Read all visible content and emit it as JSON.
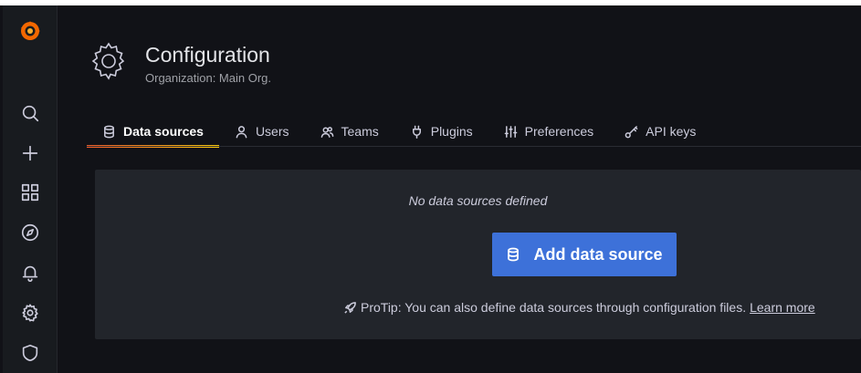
{
  "sidebar": {
    "logo": "grafana-logo",
    "items": [
      {
        "icon": "search-icon"
      },
      {
        "icon": "plus-icon"
      },
      {
        "icon": "dashboards-icon"
      },
      {
        "icon": "explore-compass-icon"
      },
      {
        "icon": "bell-icon"
      },
      {
        "icon": "gear-icon"
      },
      {
        "icon": "shield-icon"
      }
    ]
  },
  "header": {
    "title": "Configuration",
    "subtitle": "Organization: Main Org."
  },
  "tabs": [
    {
      "label": "Data sources",
      "icon": "database-icon",
      "active": true
    },
    {
      "label": "Users",
      "icon": "user-icon"
    },
    {
      "label": "Teams",
      "icon": "users-icon"
    },
    {
      "label": "Plugins",
      "icon": "plug-icon"
    },
    {
      "label": "Preferences",
      "icon": "sliders-icon"
    },
    {
      "label": "API keys",
      "icon": "key-icon"
    }
  ],
  "empty_state": {
    "title": "No data sources defined",
    "button_label": "Add data source",
    "protip_text": "ProTip: You can also define data sources through configuration files.",
    "learn_more": "Learn more"
  },
  "colors": {
    "background": "#111217",
    "sidebar": "#181b1f",
    "card": "#22252b",
    "primary_button": "#3d71d9",
    "tab_underline": "#f05a28"
  }
}
